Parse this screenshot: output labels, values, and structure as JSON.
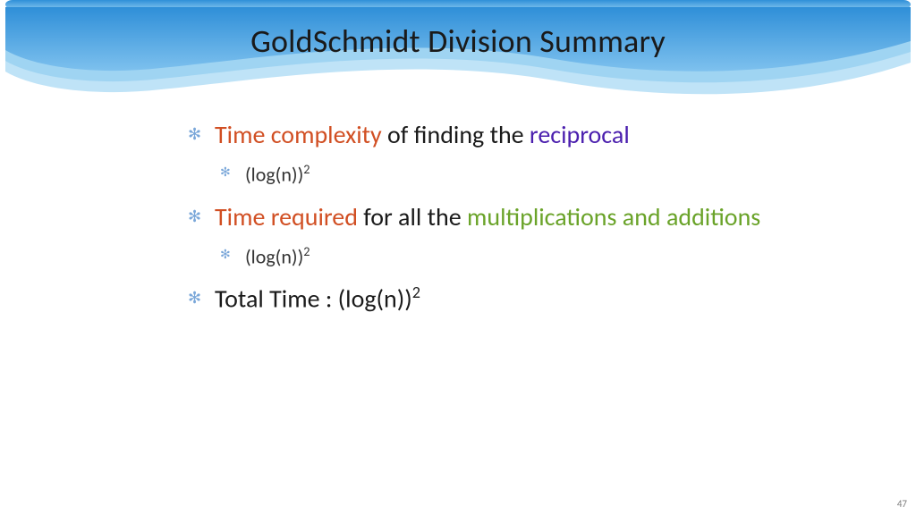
{
  "title": "GoldSchmidt Division Summary",
  "colors": {
    "red": "#d14f23",
    "purple": "#4b1fae",
    "green": "#6aa329",
    "text": "#1a1a1a"
  },
  "bullets": {
    "b1a": {
      "red": "Time complexity",
      "mid": " of finding the ",
      "purple": "reciprocal"
    },
    "b1a_sub": {
      "base": "(log(n))",
      "sup": "2"
    },
    "b1b": {
      "red": "Time required",
      "mid": " for all the ",
      "green": "multiplications and additions"
    },
    "b1b_sub": {
      "base": "(log(n))",
      "sup": "2"
    },
    "b1c": {
      "pre": "Total Time : (log(n))",
      "sup": "2"
    }
  },
  "page_number": "47"
}
